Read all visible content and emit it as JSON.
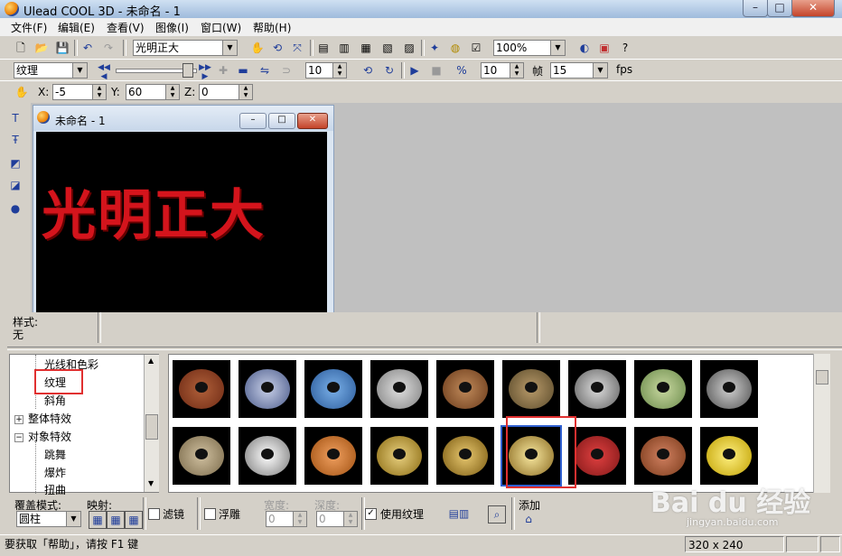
{
  "window": {
    "title": "Ulead COOL 3D - 未命名 - 1",
    "minimize": "–",
    "maximize": "□",
    "close": "✕"
  },
  "menu": [
    "文件(F)",
    "编辑(E)",
    "查看(V)",
    "图像(I)",
    "窗口(W)",
    "帮助(H)"
  ],
  "toolbar1": {
    "text_combo": "光明正大",
    "zoom_combo": "100%"
  },
  "toolbar2": {
    "attribute_combo": "纹理",
    "frame_value": "10",
    "speed_value": "10",
    "frame_label": "帧",
    "fps_value": "15",
    "fps_label": "fps"
  },
  "toolbar3": {
    "x_label": "X:",
    "x_value": "-5",
    "y_label": "Y:",
    "y_value": "60",
    "z_label": "Z:",
    "z_value": "0"
  },
  "document": {
    "title": "未命名 - 1",
    "canvas_text": "光明正大"
  },
  "style_info": {
    "label": "样式:",
    "value": "无"
  },
  "tree": {
    "items": [
      "光线和色彩",
      "纹理",
      "斜角",
      "整体特效",
      "对象特效",
      "跳舞",
      "爆炸",
      "扭曲"
    ]
  },
  "bottom": {
    "cover_mode_label": "覆盖模式:",
    "cover_mode_value": "圆柱",
    "mapping_label": "映射:",
    "filter_label": "滤镜",
    "emboss_label": "浮雕",
    "width_label": "宽度:",
    "width_value": "0",
    "depth_label": "深度:",
    "depth_value": "0",
    "use_texture_label": "使用纹理",
    "add_label": "添加"
  },
  "status": {
    "help_text": "要获取「帮助」，请按 F1 键",
    "canvas_size": "320 x 240"
  },
  "watermark": {
    "logo": "Bai du 经验",
    "url": "jingyan.baidu.com"
  },
  "colors": {
    "accent_red": "#e03030",
    "canvas_text": "#d4141c"
  }
}
